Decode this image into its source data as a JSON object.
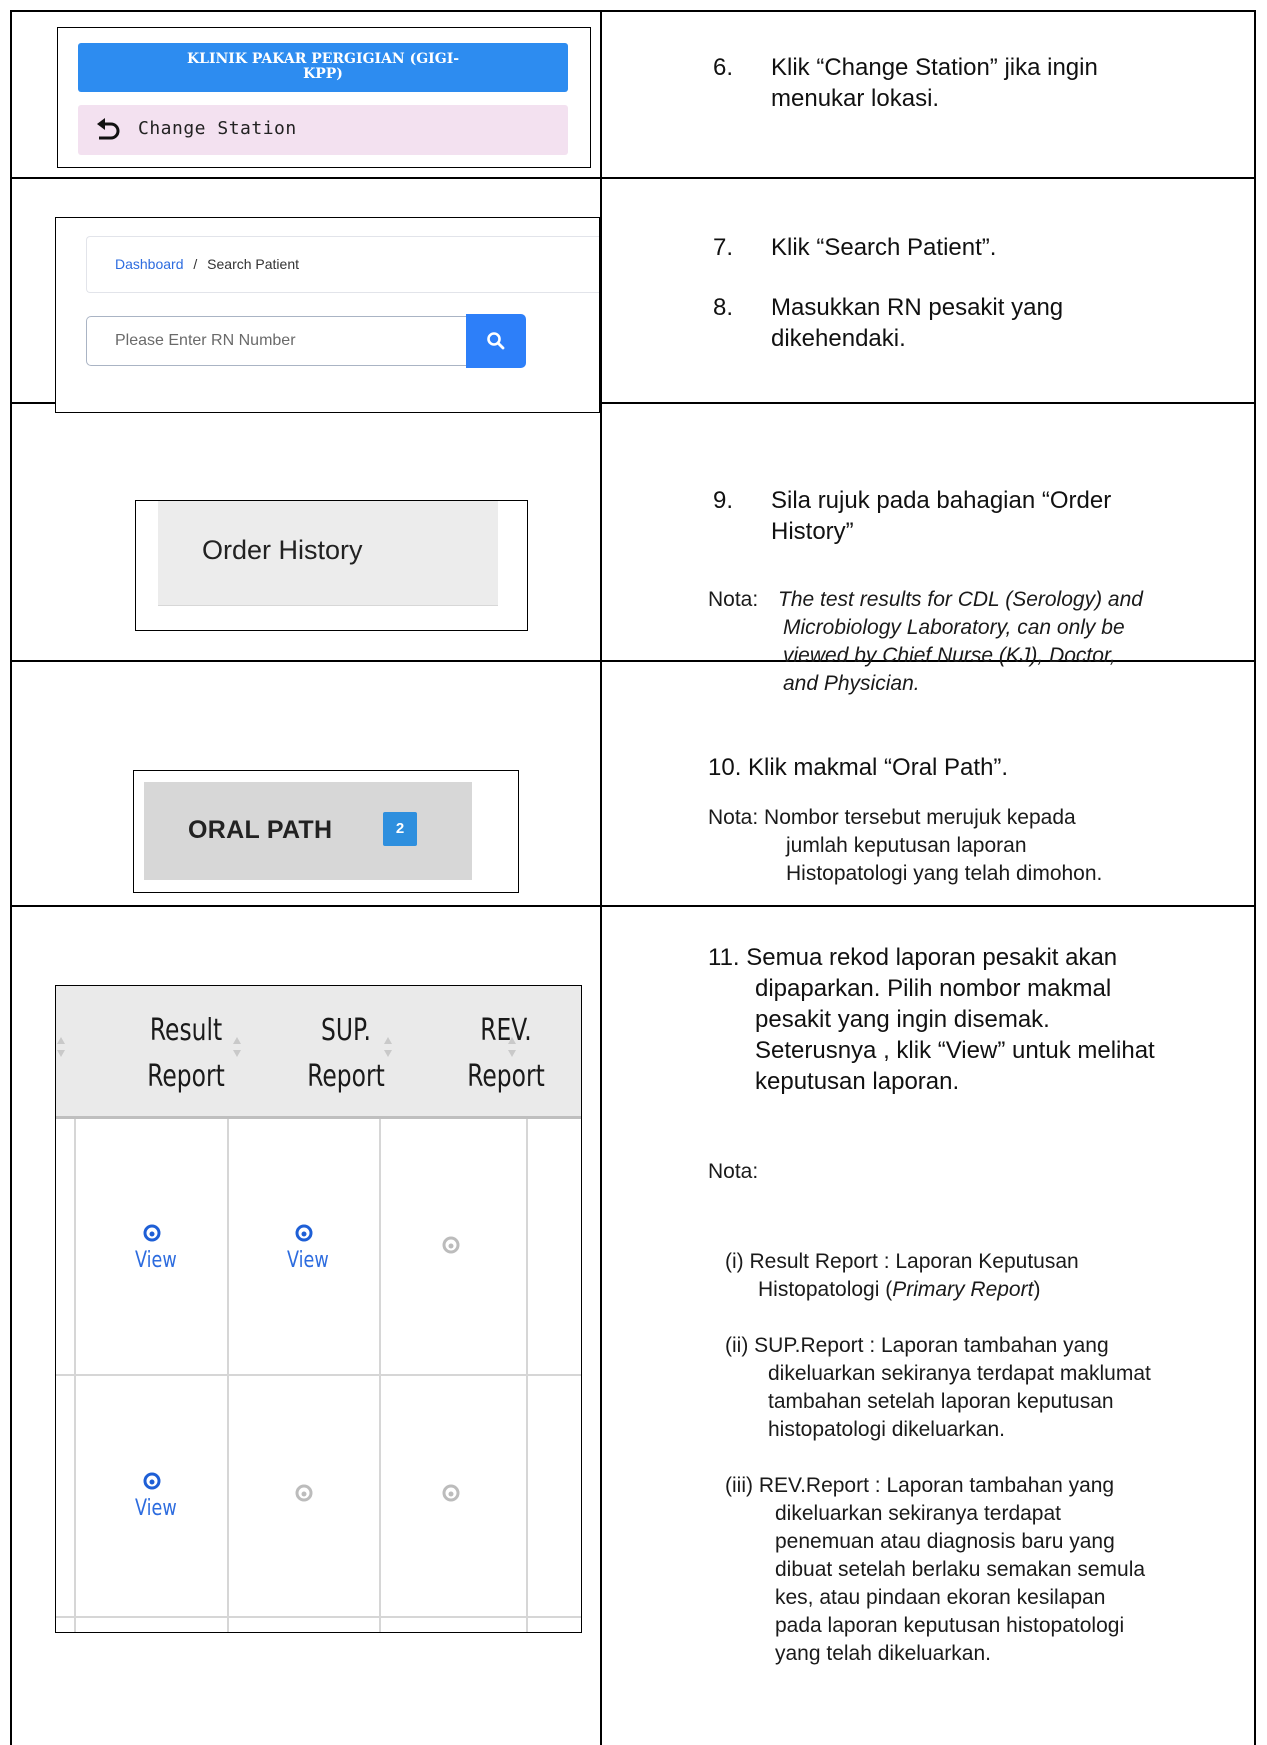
{
  "row1": {
    "station_button": "KLINIK PAKAR PERGIGIAN (GIGI-KPP)",
    "station_button_line1": "KLINIK PAKAR PERGIGIAN (GIGI-",
    "station_button_line2": "KPP)",
    "change_station_label": "Change Station",
    "step_number": "6.",
    "step_line1": "Klik “Change Station” jika ingin",
    "step_line2": "menukar lokasi."
  },
  "row2": {
    "breadcrumb_home": "Dashboard",
    "breadcrumb_sep": "/",
    "breadcrumb_current": "Search Patient",
    "rn_placeholder": "Please Enter RN Number",
    "step7_number": "7.",
    "step7_text": "Klik “Search Patient”.",
    "step8_number": "8.",
    "step8_line1": "Masukkan RN pesakit yang",
    "step8_line2": "dikehendaki."
  },
  "row3": {
    "order_history_label": "Order History",
    "step_number": "9.",
    "step_line1": "Sila rujuk pada bahagian “Order",
    "step_line2": "History”",
    "nota_label": "Nota:",
    "nota_line1": "The test results for CDL (Serology) and",
    "nota_line2": "Microbiology Laboratory, can only be",
    "nota_line3": "viewed by Chief Nurse (KJ), Doctor,",
    "nota_line4": "and Physician."
  },
  "row4": {
    "oral_path_label": "ORAL PATH",
    "oral_path_count": "2",
    "step_text": "10. Klik makmal “Oral Path”.",
    "nota_line1": "Nota: Nombor tersebut merujuk kepada",
    "nota_line2": "jumlah keputusan laporan",
    "nota_line3": "Histopatologi yang telah dimohon."
  },
  "row5": {
    "col_result_line1": "Result",
    "col_result_line2": "Report",
    "col_sup_line1": "SUP.",
    "col_sup_line2": "Report",
    "col_rev_line1": "REV.",
    "col_rev_line2": "Report",
    "view_label": "View",
    "table_rows": [
      {
        "result": "view",
        "sup": "view",
        "rev": "disabled"
      },
      {
        "result": "view",
        "sup": "disabled",
        "rev": "disabled"
      }
    ],
    "step_line1": "11. Semua rekod laporan pesakit akan",
    "step_line2": "dipaparkan. Pilih  nombor makmal",
    "step_line3": "pesakit yang ingin disemak.",
    "step_line4": "Seterusnya , klik  “View” untuk melihat",
    "step_line5": "keputusan laporan.",
    "nota_label": "Nota:",
    "note_i_line1": "(i) Result Report : Laporan Keputusan",
    "note_i_line2_pre": "Histopatologi (",
    "note_i_line2_ital": "Primary Report",
    "note_i_line2_post": ")",
    "note_ii_line1": "(ii) SUP.Report : Laporan tambahan yang",
    "note_ii_line2": "dikeluarkan sekiranya terdapat maklumat",
    "note_ii_line3": "tambahan setelah laporan keputusan",
    "note_ii_line4": "histopatologi dikeluarkan.",
    "note_iii_line1": "(iii) REV.Report : Laporan tambahan yang",
    "note_iii_line2": "dikeluarkan sekiranya terdapat",
    "note_iii_line3": "penemuan atau diagnosis baru yang",
    "note_iii_line4": "dibuat setelah berlaku semakan semula",
    "note_iii_line5": "kes, atau pindaan ekoran kesilapan",
    "note_iii_line6": "pada laporan keputusan histopatologi",
    "note_iii_line7": "yang telah dikeluarkan."
  },
  "colors": {
    "accent_blue": "#2d8cf0",
    "search_blue": "#2d7ff9",
    "change_bg": "#f3e1f0",
    "badge_blue": "#2e8fde",
    "link_blue": "#2d6cdf"
  }
}
